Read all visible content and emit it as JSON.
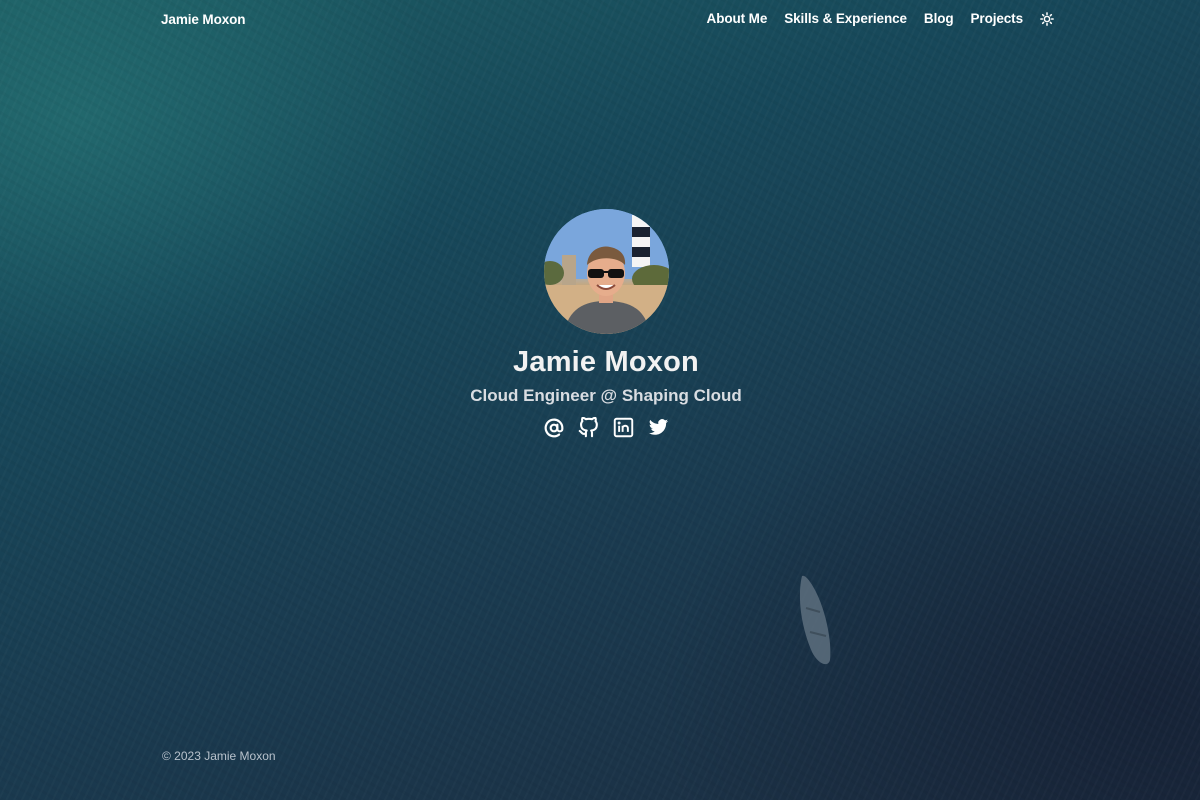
{
  "header": {
    "brand": "Jamie Moxon",
    "nav": [
      {
        "label": "About Me"
      },
      {
        "label": "Skills & Experience"
      },
      {
        "label": "Blog"
      },
      {
        "label": "Projects"
      }
    ],
    "theme_toggle_icon": "sun-icon"
  },
  "hero": {
    "avatar_alt": "Jamie Moxon",
    "name": "Jamie Moxon",
    "subtitle": "Cloud Engineer @ Shaping Cloud",
    "socials": [
      {
        "icon": "at-sign-icon"
      },
      {
        "icon": "github-icon"
      },
      {
        "icon": "linkedin-icon"
      },
      {
        "icon": "twitter-icon"
      }
    ]
  },
  "footer": {
    "copyright": "© 2023 Jamie Moxon"
  },
  "colors": {
    "background_top": "#1d5c63",
    "background_bottom": "#1c2c40",
    "text": "#ffffff",
    "subtitle": "#d9dde2",
    "footer_text": "#b8c2cc"
  }
}
